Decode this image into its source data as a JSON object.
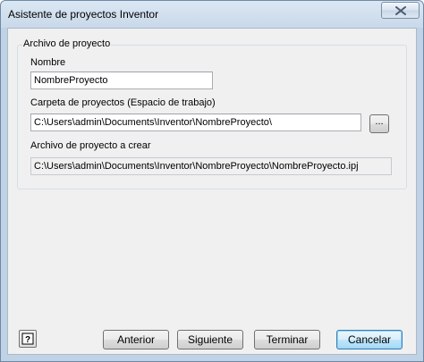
{
  "window": {
    "title": "Asistente de proyectos Inventor",
    "close_icon": "close-icon"
  },
  "group": {
    "legend": "Archivo de proyecto"
  },
  "fields": {
    "name_label": "Nombre",
    "name_value": "NombreProyecto",
    "folder_label": "Carpeta de proyectos (Espacio de trabajo)",
    "folder_value": "C:\\Users\\admin\\Documents\\Inventor\\NombreProyecto\\",
    "browse_label": "...",
    "file_label": "Archivo de proyecto a crear",
    "file_value": "C:\\Users\\admin\\Documents\\Inventor\\NombreProyecto\\NombreProyecto.ipj"
  },
  "buttons": {
    "help_icon": "help-icon",
    "back": "Anterior",
    "next": "Siguiente",
    "finish": "Terminar",
    "cancel": "Cancelar"
  }
}
